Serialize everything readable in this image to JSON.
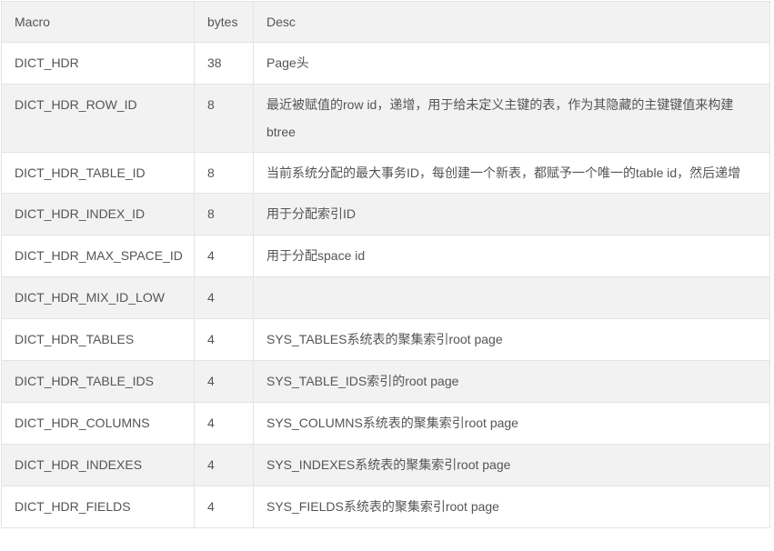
{
  "table": {
    "headers": [
      "Macro",
      "bytes",
      "Desc"
    ],
    "rows": [
      {
        "macro": "DICT_HDR",
        "bytes": "38",
        "desc": "Page头"
      },
      {
        "macro": "DICT_HDR_ROW_ID",
        "bytes": "8",
        "desc": "最近被赋值的row id，递增，用于给未定义主键的表，作为其隐藏的主键键值来构建btree"
      },
      {
        "macro": "DICT_HDR_TABLE_ID",
        "bytes": "8",
        "desc": "当前系统分配的最大事务ID，每创建一个新表，都赋予一个唯一的table id，然后递增"
      },
      {
        "macro": "DICT_HDR_INDEX_ID",
        "bytes": "8",
        "desc": "用于分配索引ID"
      },
      {
        "macro": "DICT_HDR_MAX_SPACE_ID",
        "bytes": "4",
        "desc": "用于分配space id"
      },
      {
        "macro": "DICT_HDR_MIX_ID_LOW",
        "bytes": "4",
        "desc": ""
      },
      {
        "macro": "DICT_HDR_TABLES",
        "bytes": "4",
        "desc": "SYS_TABLES系统表的聚集索引root page"
      },
      {
        "macro": "DICT_HDR_TABLE_IDS",
        "bytes": "4",
        "desc": "SYS_TABLE_IDS索引的root page"
      },
      {
        "macro": "DICT_HDR_COLUMNS",
        "bytes": "4",
        "desc": "SYS_COLUMNS系统表的聚集索引root page"
      },
      {
        "macro": "DICT_HDR_INDEXES",
        "bytes": "4",
        "desc": "SYS_INDEXES系统表的聚集索引root page"
      },
      {
        "macro": "DICT_HDR_FIELDS",
        "bytes": "4",
        "desc": "SYS_FIELDS系统表的聚集索引root page"
      }
    ]
  }
}
